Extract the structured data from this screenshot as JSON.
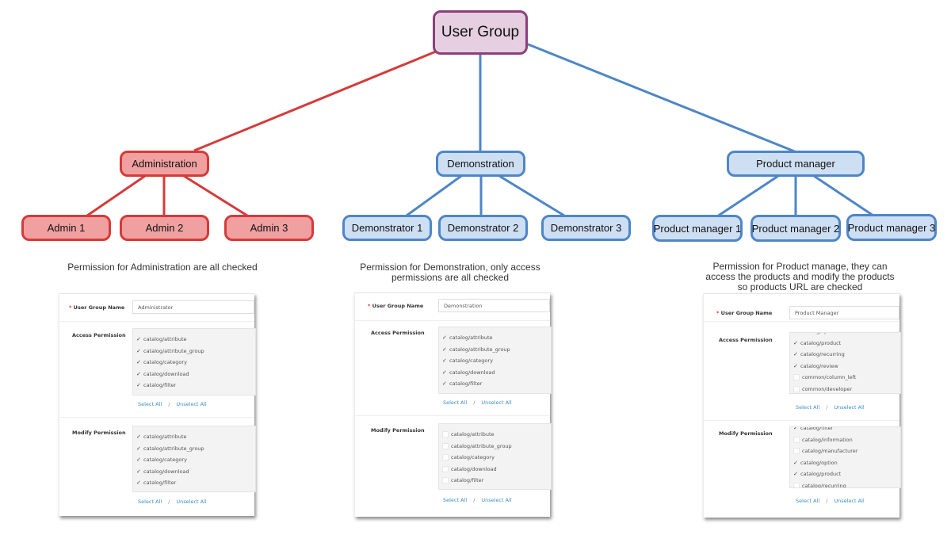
{
  "colors": {
    "root_fill": "#e6cfe1",
    "root_border": "#8b3f7c",
    "admin_fill": "#f0a0a0",
    "admin_border": "#d63a3a",
    "blue_fill": "#cfdff3",
    "blue_border": "#4e86c8",
    "link_blue": "#3c8fc4"
  },
  "tree": {
    "root": "User Group",
    "groups": [
      {
        "label": "Administration",
        "color": "red",
        "children": [
          "Admin 1",
          "Admin 2",
          "Admin 3"
        ]
      },
      {
        "label": "Demonstration",
        "color": "blue",
        "children": [
          "Demonstrator 1",
          "Demonstrator 2",
          "Demonstrator 3"
        ]
      },
      {
        "label": "Product manager",
        "color": "blue",
        "children": [
          "Product manager 1",
          "Product manager 2",
          "Product manager 3"
        ]
      }
    ]
  },
  "captions": [
    "Permission for Administration are all checked",
    "Permission for Demonstration, only access permissions are all checked",
    "Permission for Product manage, they can access the products and modify the products so products URL are checked"
  ],
  "form_labels": {
    "required_mark": "*",
    "name_label": "User Group Name",
    "access_label": "Access Permission",
    "modify_label": "Modify Permission",
    "select_all": "Select All",
    "separator": "/",
    "unselect_all": "Unselect All"
  },
  "panels": [
    {
      "group_name": "Administrator",
      "access": [
        {
          "name": "catalog/attribute",
          "checked": true
        },
        {
          "name": "catalog/attribute_group",
          "checked": true
        },
        {
          "name": "catalog/category",
          "checked": true
        },
        {
          "name": "catalog/download",
          "checked": true
        },
        {
          "name": "catalog/filter",
          "checked": true
        }
      ],
      "modify": [
        {
          "name": "catalog/attribute",
          "checked": true
        },
        {
          "name": "catalog/attribute_group",
          "checked": true
        },
        {
          "name": "catalog/category",
          "checked": true
        },
        {
          "name": "catalog/download",
          "checked": true
        },
        {
          "name": "catalog/filter",
          "checked": true
        }
      ]
    },
    {
      "group_name": "Demonstration",
      "access": [
        {
          "name": "catalog/attribute",
          "checked": true
        },
        {
          "name": "catalog/attribute_group",
          "checked": true
        },
        {
          "name": "catalog/category",
          "checked": true
        },
        {
          "name": "catalog/download",
          "checked": true
        },
        {
          "name": "catalog/filter",
          "checked": true
        }
      ],
      "modify": [
        {
          "name": "catalog/attribute",
          "checked": false
        },
        {
          "name": "catalog/attribute_group",
          "checked": false
        },
        {
          "name": "catalog/category",
          "checked": false
        },
        {
          "name": "catalog/download",
          "checked": false
        },
        {
          "name": "catalog/filter",
          "checked": false
        }
      ]
    },
    {
      "group_name": "Product Manager",
      "access": [
        {
          "name": "catalog/option",
          "checked": true
        },
        {
          "name": "catalog/product",
          "checked": true
        },
        {
          "name": "catalog/recurring",
          "checked": true
        },
        {
          "name": "catalog/review",
          "checked": true
        },
        {
          "name": "common/column_left",
          "checked": false
        },
        {
          "name": "common/developer",
          "checked": false
        }
      ],
      "modify": [
        {
          "name": "catalog/filter",
          "checked": true
        },
        {
          "name": "catalog/information",
          "checked": false
        },
        {
          "name": "catalog/manufacturer",
          "checked": false
        },
        {
          "name": "catalog/option",
          "checked": true
        },
        {
          "name": "catalog/product",
          "checked": true
        },
        {
          "name": "catalog/recurring",
          "checked": false
        }
      ]
    }
  ]
}
